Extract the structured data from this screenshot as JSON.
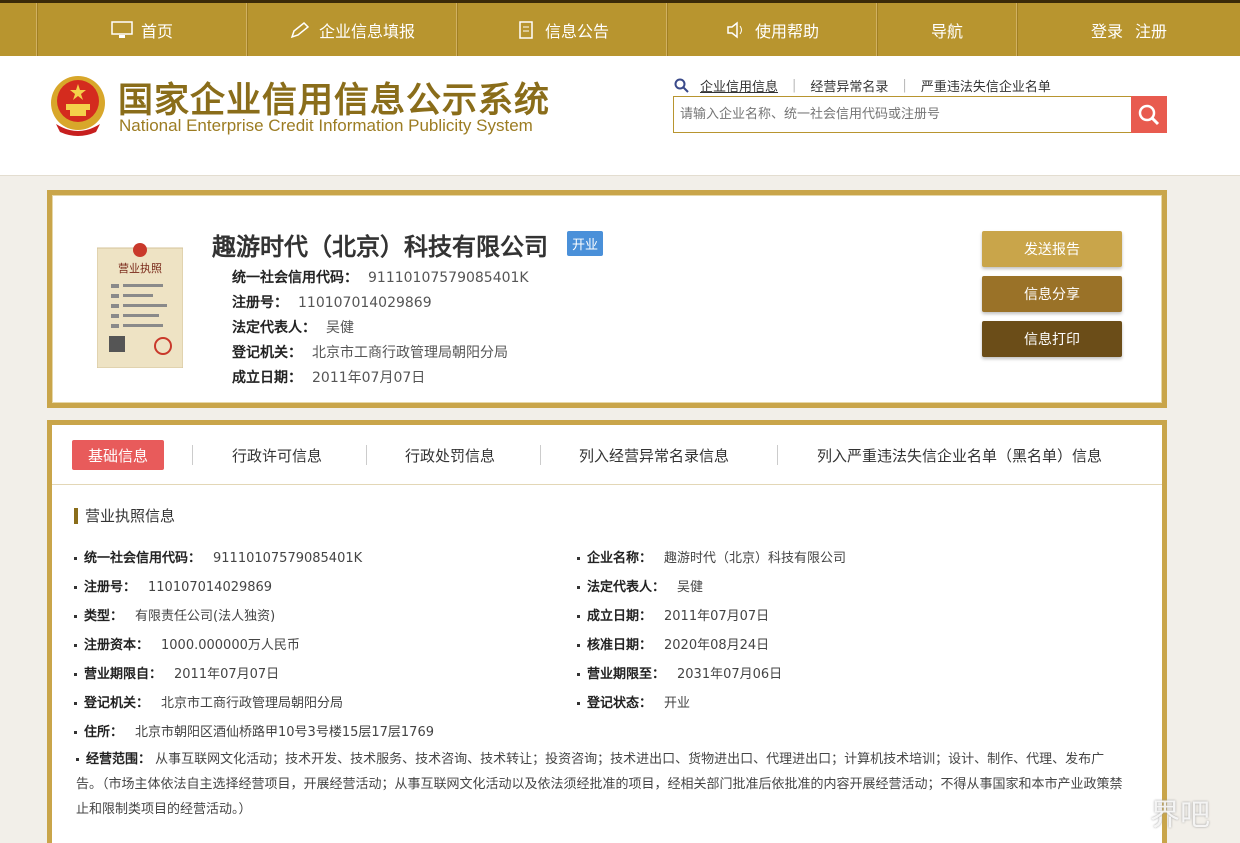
{
  "nav": {
    "items": [
      {
        "label": "首页",
        "icon": "monitor-icon"
      },
      {
        "label": "企业信息填报",
        "icon": "pen-icon"
      },
      {
        "label": "信息公告",
        "icon": "document-icon"
      },
      {
        "label": "使用帮助",
        "icon": "speaker-icon"
      },
      {
        "label": "导航",
        "icon": ""
      }
    ],
    "login": "登录",
    "register": "注册"
  },
  "header": {
    "title": "国家企业信用信息公示系统",
    "subtitle": "National Enterprise Credit Information Publicity System",
    "search_links": [
      "企业信用信息",
      "经营异常名录",
      "严重违法失信企业名单"
    ],
    "search_placeholder": "请输入企业名称、统一社会信用代码或注册号"
  },
  "company": {
    "name": "趣游时代（北京）科技有限公司",
    "status": "开业",
    "fields": [
      {
        "label": "统一社会信用代码：",
        "value": "91110107579085401K"
      },
      {
        "label": "注册号：",
        "value": "110107014029869"
      },
      {
        "label": "法定代表人：",
        "value": "吴健"
      },
      {
        "label": "登记机关：",
        "value": "北京市工商行政管理局朝阳分局"
      },
      {
        "label": "成立日期：",
        "value": "2011年07月07日"
      }
    ],
    "license_title": "营业执照",
    "actions": [
      {
        "label": "发送报告",
        "color": "#c9a54a"
      },
      {
        "label": "信息分享",
        "color": "#9a7228"
      },
      {
        "label": "信息打印",
        "color": "#6b4d18"
      }
    ]
  },
  "tabs": [
    "基础信息",
    "行政许可信息",
    "行政处罚信息",
    "列入经营异常名录信息",
    "列入严重违法失信企业名单（黑名单）信息"
  ],
  "details": {
    "section_title": "营业执照信息",
    "left": [
      {
        "label": "统一社会信用代码：",
        "value": "91110107579085401K"
      },
      {
        "label": "注册号：",
        "value": "110107014029869"
      },
      {
        "label": "类型：",
        "value": "有限责任公司(法人独资)"
      },
      {
        "label": "注册资本：",
        "value": "1000.000000万人民币"
      },
      {
        "label": "营业期限自：",
        "value": "2011年07月07日"
      },
      {
        "label": "登记机关：",
        "value": "北京市工商行政管理局朝阳分局"
      },
      {
        "label": "住所：",
        "value": "北京市朝阳区酒仙桥路甲10号3号楼15层17层1769"
      }
    ],
    "right": [
      {
        "label": "企业名称：",
        "value": "趣游时代（北京）科技有限公司"
      },
      {
        "label": "法定代表人：",
        "value": "吴健"
      },
      {
        "label": "成立日期：",
        "value": "2011年07月07日"
      },
      {
        "label": "核准日期：",
        "value": "2020年08月24日"
      },
      {
        "label": "营业期限至：",
        "value": "2031年07月06日"
      },
      {
        "label": "登记状态：",
        "value": "开业"
      }
    ],
    "scope_label": "经营范围：",
    "scope_value": "从事互联网文化活动；技术开发、技术服务、技术咨询、技术转让；投资咨询；技术进出口、货物进出口、代理进出口；计算机技术培训；设计、制作、代理、发布广告。（市场主体依法自主选择经营项目，开展经营活动；从事互联网文化活动以及依法须经批准的项目，经相关部门批准后依批准的内容开展经营活动；不得从事国家和本市产业政策禁止和限制类项目的经营活动。）"
  },
  "watermark": "界吧"
}
